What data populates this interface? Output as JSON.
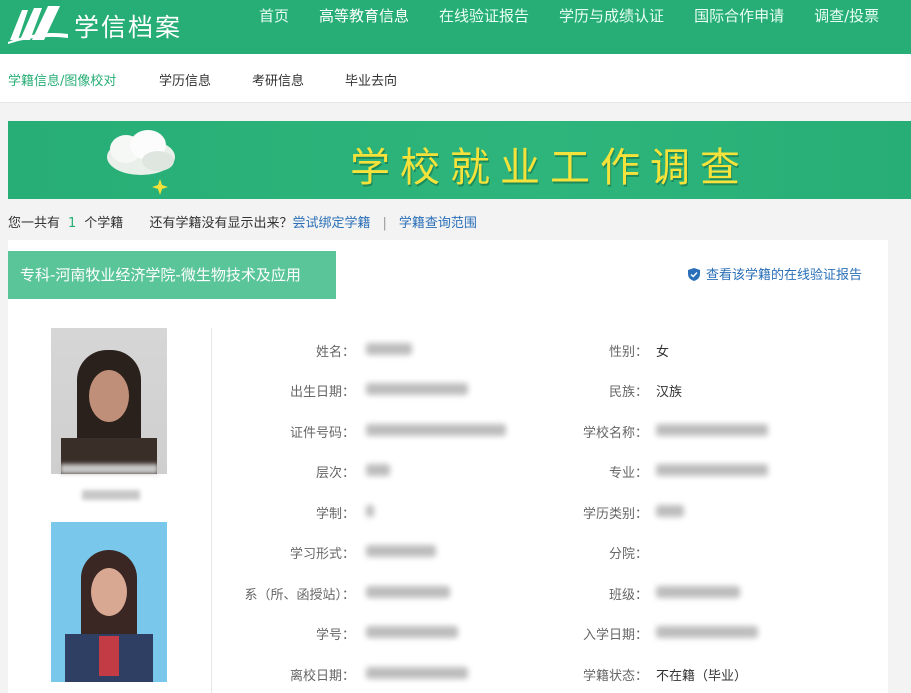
{
  "brand": {
    "name": "学信档案"
  },
  "nav": [
    "首页",
    "高等教育信息",
    "在线验证报告",
    "学历与成绩认证",
    "国际合作申请",
    "调查/投票"
  ],
  "subnav": [
    "学籍信息/图像校对",
    "学历信息",
    "考研信息",
    "毕业去向"
  ],
  "banner": {
    "title": "学校就业工作调查"
  },
  "info": {
    "prefix": "您一共有",
    "count": "1",
    "suffix": "个学籍",
    "question": "还有学籍没有显示出来？",
    "bind_link": "尝试绑定学籍",
    "separator": "|",
    "scope_link": "学籍查询范围"
  },
  "record": {
    "tag": "专科-河南牧业经济学院-微生物技术及应用",
    "verify_link": "查看该学籍的在线验证报告",
    "left_labels": [
      "姓名：",
      "出生日期：",
      "证件号码：",
      "层次：",
      "学制：",
      "学习形式：",
      "系（所、函授站）：",
      "学号：",
      "离校日期："
    ],
    "right_labels": [
      "性别：",
      "民族：",
      "学校名称：",
      "专业：",
      "学历类别：",
      "分院：",
      "班级：",
      "入学日期：",
      "学籍状态："
    ],
    "gender": "女",
    "ethnicity": "汉族",
    "status": "不在籍（毕业）"
  },
  "colors": {
    "primary": "#27ae76",
    "link": "#2a6fb7",
    "tag": "#5bc59a",
    "banner_text": "#f5e23a"
  }
}
